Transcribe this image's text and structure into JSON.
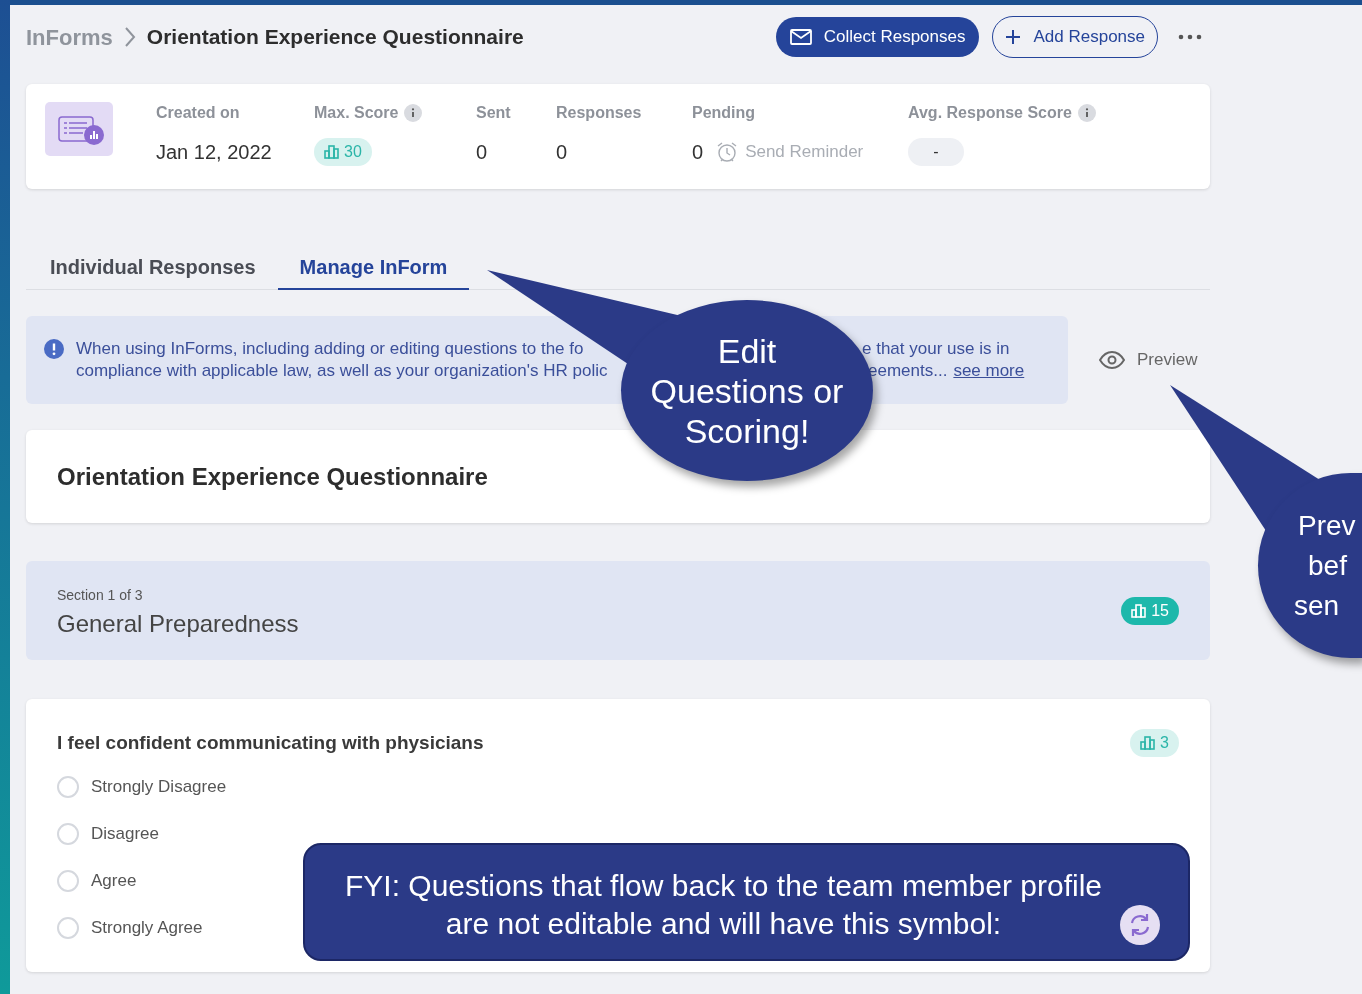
{
  "breadcrumb": {
    "parent": "InForms",
    "title": "Orientation Experience Questionnaire"
  },
  "actions": [
    {
      "label": "Collect Responses",
      "kind": "primary"
    },
    {
      "label": "Add Response",
      "kind": "outline"
    }
  ],
  "stats": [
    {
      "label": "Created on",
      "info": false,
      "kind": "text",
      "value": "Jan 12, 2022"
    },
    {
      "label": "Max. Score",
      "info": true,
      "kind": "score",
      "value": "30"
    },
    {
      "label": "Sent",
      "info": false,
      "kind": "text",
      "value": "0"
    },
    {
      "label": "Responses",
      "info": false,
      "kind": "text",
      "value": "0"
    },
    {
      "label": "Pending",
      "info": false,
      "kind": "reminder",
      "value": "0",
      "action": "Send Reminder"
    },
    {
      "label": "Avg. Response Score",
      "info": true,
      "kind": "pill",
      "value": "-"
    }
  ],
  "tabs": [
    {
      "label": "Individual Responses",
      "selected": false
    },
    {
      "label": "Manage InForm",
      "selected": true
    }
  ],
  "notice": {
    "lines": [
      {
        "left": "When using InForms, including adding or editing questions to the fo",
        "right": "e that your use is in"
      },
      {
        "left": "compliance with applicable law, as well as your organization's HR polic",
        "right": "eements..."
      }
    ],
    "link": "see more"
  },
  "preview": "Preview",
  "form_title": "Orientation Experience Questionnaire",
  "section": {
    "caption": "Section 1 of 3",
    "title": "General Preparedness",
    "score": "15"
  },
  "question": {
    "text": "I feel confident communicating with physicians",
    "score": "3",
    "options": [
      {
        "label": "Strongly Disagree",
        "selected": false
      },
      {
        "label": "Disagree",
        "selected": false
      },
      {
        "label": "Agree",
        "selected": false
      },
      {
        "label": "Strongly Agree",
        "selected": false
      }
    ]
  },
  "annotations": {
    "edit_callout": "Edit Questions or Scoring!",
    "preview_callout": [
      "Prev",
      "bef",
      "sen"
    ],
    "fyi_note": "FYI: Questions that flow back to the team member profile are not editable and will have this symbol:"
  }
}
